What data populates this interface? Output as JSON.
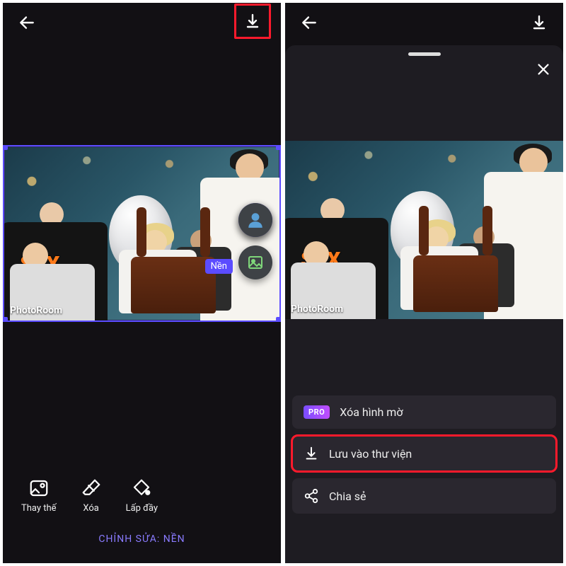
{
  "left": {
    "watermark": "PhotoRoom",
    "layer_label": "Nền",
    "tools": {
      "replace": "Thay thế",
      "delete": "Xóa",
      "fill": "Lấp đầy"
    },
    "footer": "CHỈNH SỬA: NỀN"
  },
  "right": {
    "watermark": "PhotoRoom",
    "menu": {
      "pro_badge": "PRO",
      "remove_watermark": "Xóa hình mờ",
      "save_to_library": "Lưu vào thư viện",
      "share": "Chia sẻ"
    }
  },
  "shirt_logo": "SLX"
}
